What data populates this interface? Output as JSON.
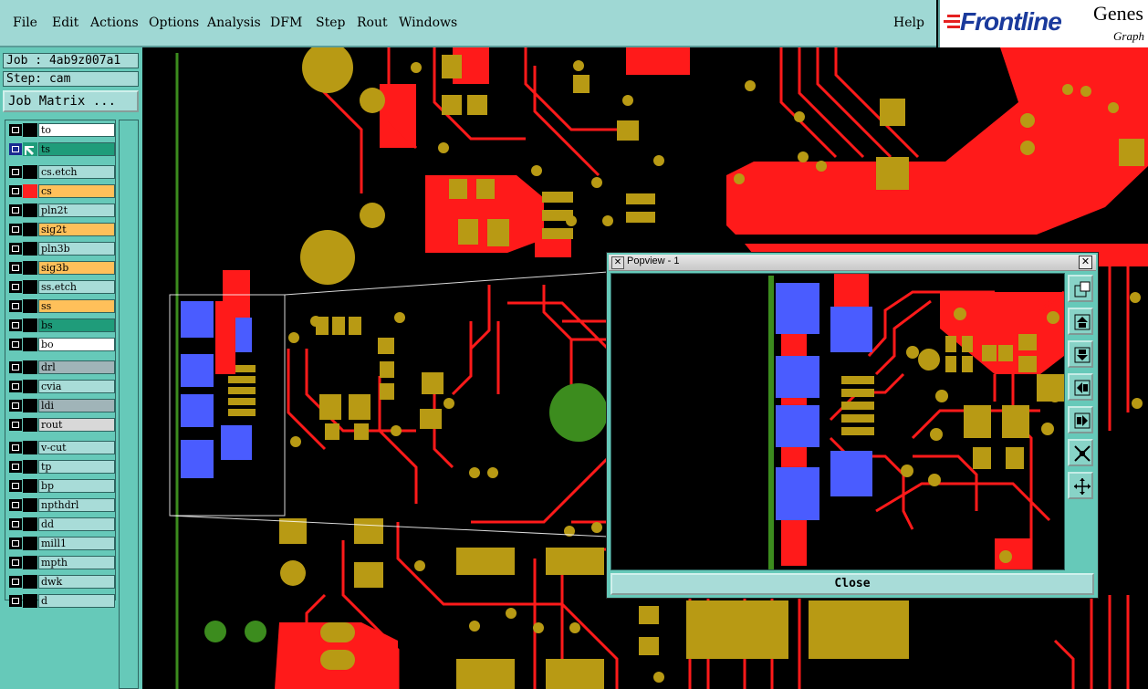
{
  "menu": {
    "file": "File",
    "edit": "Edit",
    "actions": "Actions",
    "options": "Options",
    "analysis": "Analysis",
    "dfm": "DFM",
    "step": "Step",
    "rout": "Rout",
    "windows": "Windows",
    "help": "Help"
  },
  "logo": {
    "brand": "Frontline",
    "product": "Genes",
    "sub": "Graph"
  },
  "job": {
    "job_line": "Job : 4ab9z007a1",
    "step_line": "Step: cam",
    "matrix_button": "Job Matrix ..."
  },
  "layers": [
    {
      "name": "to",
      "color": "#ffffff",
      "mk": "#000000"
    },
    {
      "name": "ts",
      "color": "#1f9c7a",
      "mk": "#1f9c7a",
      "active": true
    },
    {
      "name": "cs.etch",
      "color": "#a8dcd8",
      "mk": "#000000"
    },
    {
      "name": "cs",
      "color": "#ffc05a",
      "mk": "#ff2020"
    },
    {
      "name": "pln2t",
      "color": "#a8dcd8",
      "mk": "#000000"
    },
    {
      "name": "sig2t",
      "color": "#ffc05a",
      "mk": "#000000"
    },
    {
      "name": "pln3b",
      "color": "#a8dcd8",
      "mk": "#000000"
    },
    {
      "name": "sig3b",
      "color": "#ffc05a",
      "mk": "#000000"
    },
    {
      "name": "ss.etch",
      "color": "#a8dcd8",
      "mk": "#000000"
    },
    {
      "name": "ss",
      "color": "#ffc05a",
      "mk": "#000000"
    },
    {
      "name": "bs",
      "color": "#1f9c7a",
      "mk": "#000000"
    },
    {
      "name": "bo",
      "color": "#ffffff",
      "mk": "#000000"
    },
    {
      "name": "drl",
      "color": "#a0b4b8",
      "mk": "#000000"
    },
    {
      "name": "cvia",
      "color": "#a8dcd8",
      "mk": "#000000"
    },
    {
      "name": "ldi",
      "color": "#a0b4b8",
      "mk": "#000000"
    },
    {
      "name": "rout",
      "color": "#d8d8d8",
      "mk": "#000000"
    },
    {
      "name": "v-cut",
      "color": "#a8dcd8",
      "mk": "#000000"
    },
    {
      "name": "tp",
      "color": "#a8dcd8",
      "mk": "#000000"
    },
    {
      "name": "bp",
      "color": "#a8dcd8",
      "mk": "#000000"
    },
    {
      "name": "npthdrl",
      "color": "#a8dcd8",
      "mk": "#000000"
    },
    {
      "name": "dd",
      "color": "#a8dcd8",
      "mk": "#000000"
    },
    {
      "name": "mill1",
      "color": "#a8dcd8",
      "mk": "#000000"
    },
    {
      "name": "mpth",
      "color": "#a8dcd8",
      "mk": "#000000"
    },
    {
      "name": "dwk",
      "color": "#a8dcd8",
      "mk": "#000000"
    },
    {
      "name": "d",
      "color": "#a8dcd8",
      "mk": "#000000"
    }
  ],
  "popview": {
    "title": "Popview - 1",
    "close_label": "Close"
  },
  "colors": {
    "pad": "#b89a14",
    "trace": "#ff1a1a",
    "blue": "#4a5cff",
    "green": "#3c8c1e",
    "ui": "#66c9b9"
  }
}
